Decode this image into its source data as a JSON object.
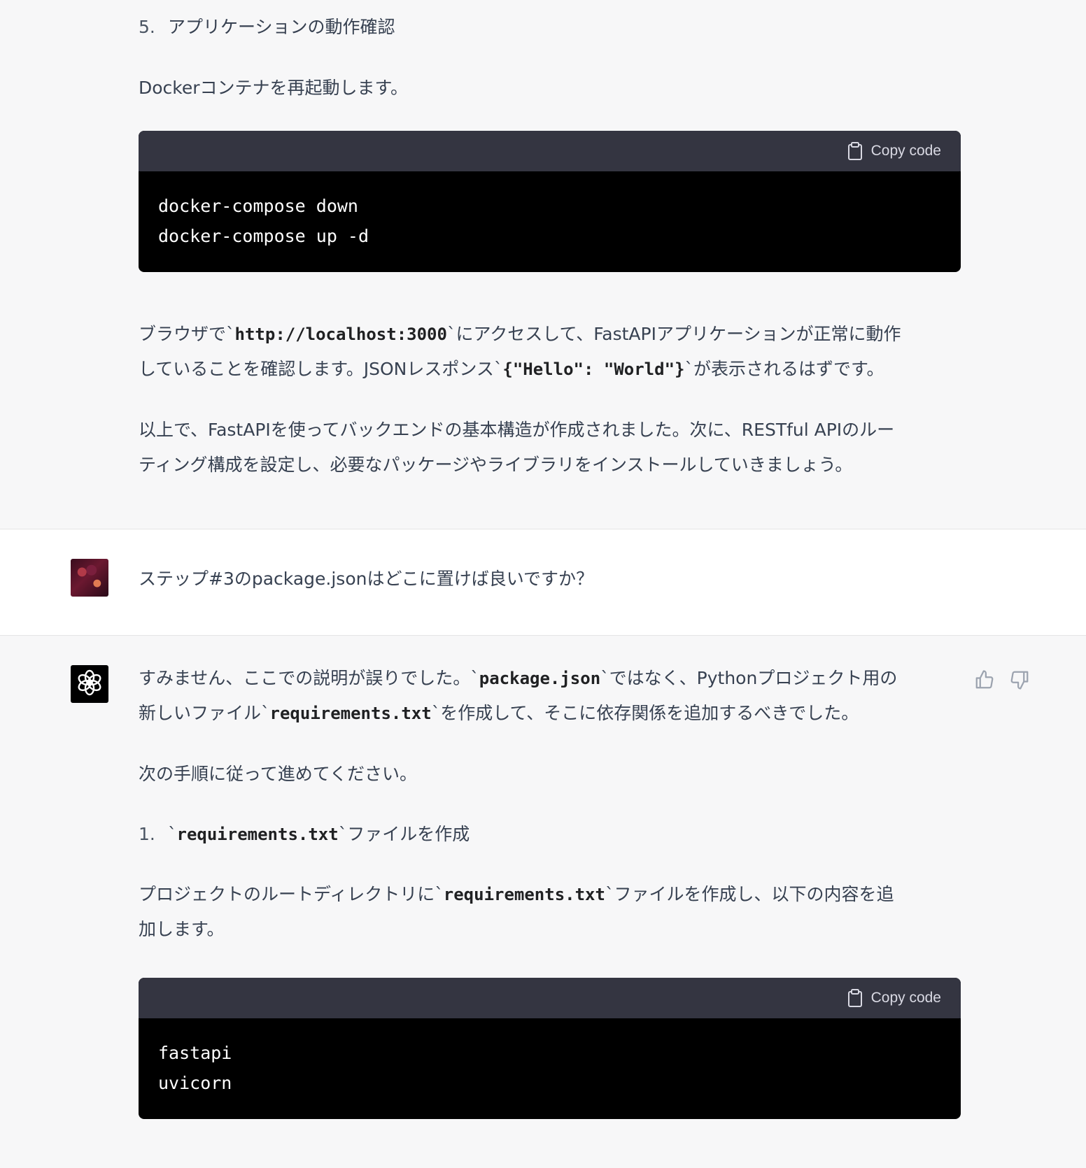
{
  "prev_answer": {
    "step5_number": "5.",
    "step5_title": "アプリケーションの動作確認",
    "restart_text": "Dockerコンテナを再起動します。",
    "code1": {
      "copy_label": "Copy code",
      "lines": [
        "docker-compose down",
        "docker-compose up -d"
      ]
    },
    "browser_text_a": "ブラウザで`",
    "browser_code_url": "http://localhost:3000",
    "browser_text_b": "`にアクセスして、FastAPIアプリケーションが正常に動作",
    "browser_text_c": "していることを確認します。JSONレスポンス`",
    "browser_code_json": "{\"Hello\": \"World\"}",
    "browser_text_d": "`が表示されるはずです。",
    "summary_line1": "以上で、FastAPIを使ってバックエンドの基本構造が作成されました。次に、RESTful APIのルー",
    "summary_line2": "ティング構成を設定し、必要なパッケージやライブラリをインストールしていきましょう。"
  },
  "user_message": {
    "text": "ステップ#3のpackage.jsonはどこに置けば良いですか？"
  },
  "answer": {
    "p1_a": "すみません、ここでの説明が誤りでした。`",
    "p1_code1": "package.json",
    "p1_b": "`ではなく、Pythonプロジェクト用の",
    "p1_c": "新しいファイル`",
    "p1_code2": "requirements.txt",
    "p1_d": "`を作成して、そこに依存関係を追加するべきでした。",
    "p2": "次の手順に従って進めてください。",
    "step1_number": "1.",
    "step1_a": "`",
    "step1_code": "requirements.txt",
    "step1_b": "`ファイルを作成",
    "p3_a": "プロジェクトのルートディレクトリに`",
    "p3_code": "requirements.txt",
    "p3_b": "`ファイルを作成し、以下の内容を追",
    "p3_c": "加します。",
    "code2": {
      "copy_label": "Copy code",
      "lines": [
        "fastapi",
        "uvicorn"
      ]
    }
  },
  "icons": {
    "copy": "clipboard-icon",
    "thumbs_up": "thumbs-up-icon",
    "thumbs_down": "thumbs-down-icon",
    "assistant_logo": "openai-logo-icon",
    "user_avatar": "user-avatar"
  },
  "colors": {
    "assistant_bg": "#f7f7f8",
    "user_bg": "#ffffff",
    "code_header": "#343541",
    "code_body": "#000000"
  }
}
